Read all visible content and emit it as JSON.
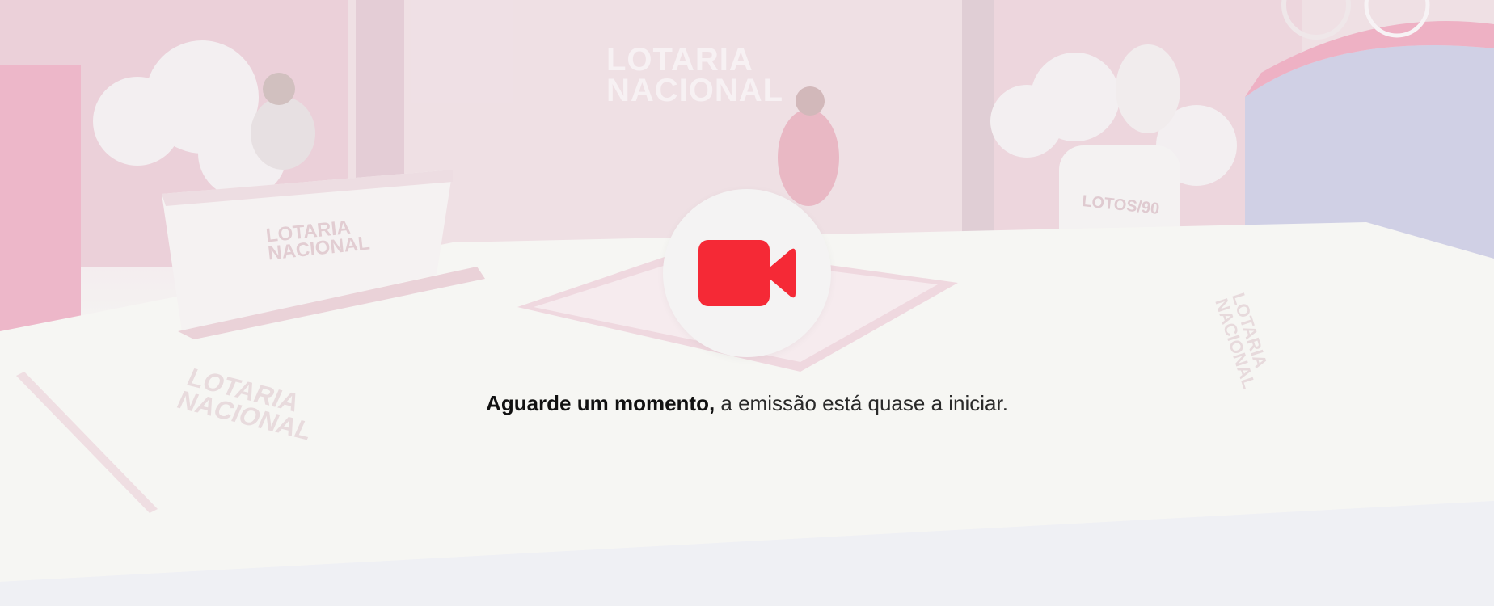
{
  "background": {
    "wall_logo_line1": "LOTARIA",
    "wall_logo_line2": "NACIONAL",
    "desk_logo_line1": "LOTARIA",
    "desk_logo_line2": "NACIONAL",
    "floor_logo_line1": "LOTARIA",
    "floor_logo_line2": "NACIONAL",
    "side_logo_line1": "LOTARIA",
    "side_logo_line2": "NACIONAL",
    "drum_label": "LOTOS/90"
  },
  "player": {
    "icon": "video-camera-icon",
    "message_bold": "Aguarde um momento,",
    "message_rest": " a emissão está quase a iniciar."
  },
  "colors": {
    "accent": "#f52936",
    "circle": "#f4f3f3",
    "text": "#2a2a2a"
  }
}
